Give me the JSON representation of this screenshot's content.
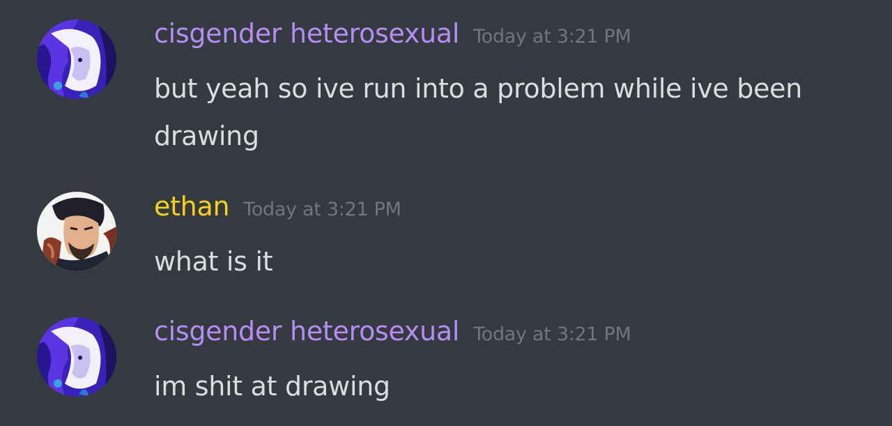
{
  "messages": [
    {
      "author": "cisgender heterosexual",
      "author_color": "#b38ef5",
      "timestamp": "Today at 3:21 PM",
      "text": "but yeah so ive run into a problem while ive been drawing",
      "avatar": "purple-character-avatar"
    },
    {
      "author": "ethan",
      "author_color": "#f8d11c",
      "timestamp": "Today at 3:21 PM",
      "text": "what is it",
      "avatar": "bearded-man-avatar"
    },
    {
      "author": "cisgender heterosexual",
      "author_color": "#b38ef5",
      "timestamp": "Today at 3:21 PM",
      "text": "im shit at drawing",
      "avatar": "purple-character-avatar"
    }
  ]
}
